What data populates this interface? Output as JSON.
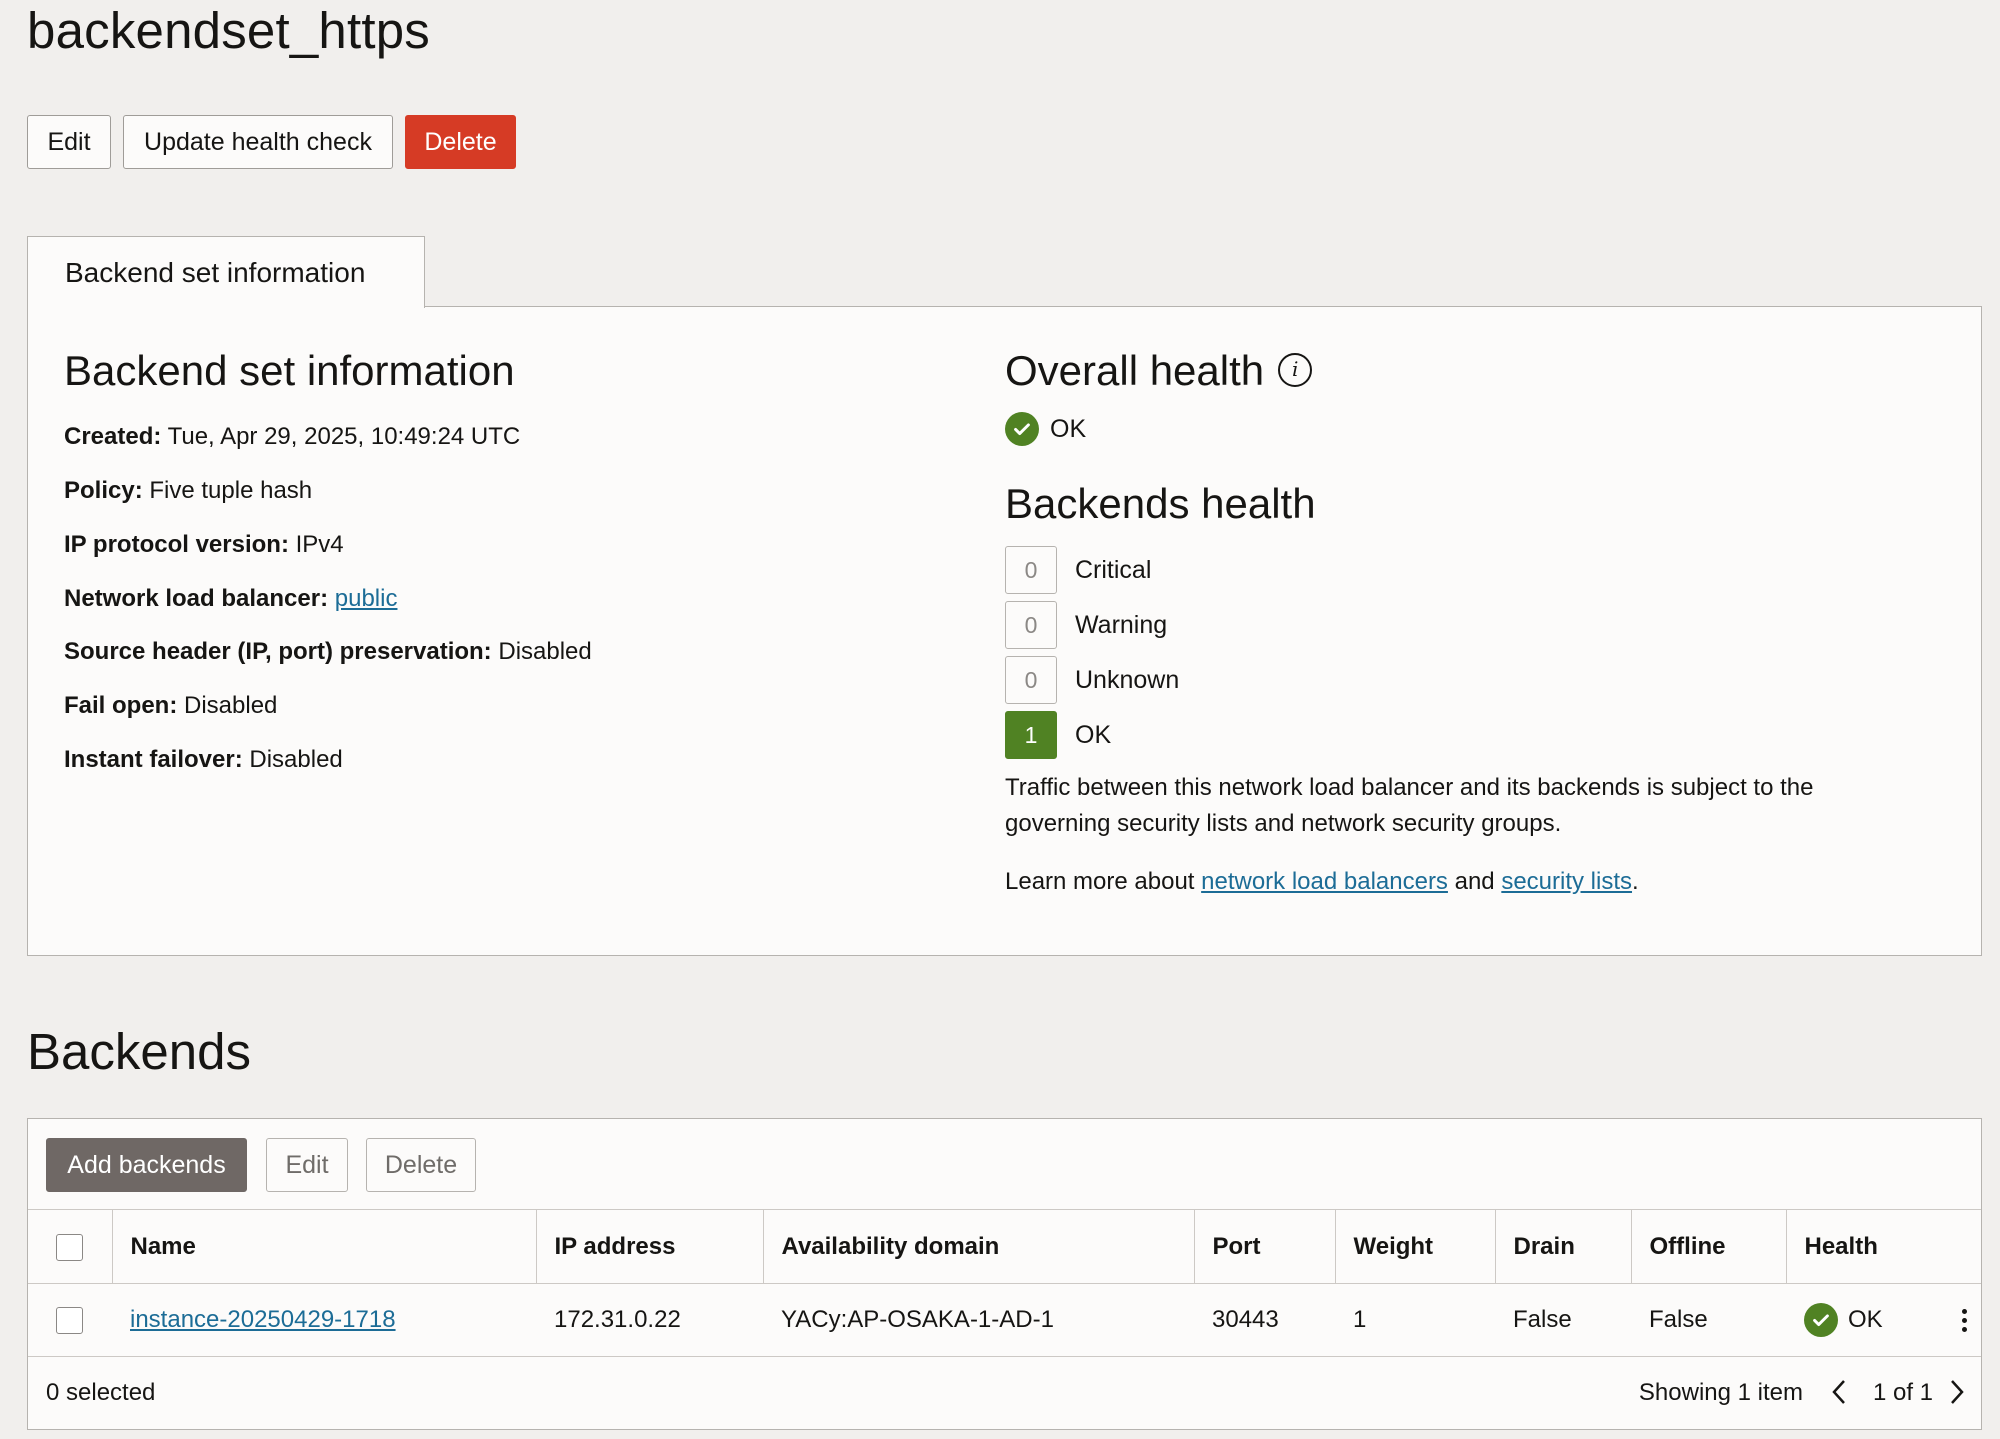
{
  "page": {
    "title": "backendset_https"
  },
  "toolbar": {
    "edit_label": "Edit",
    "update_health_label": "Update health check",
    "delete_label": "Delete"
  },
  "tabs": [
    {
      "label": "Backend set information"
    }
  ],
  "info": {
    "heading": "Backend set information",
    "created_label": "Created:",
    "created_value": "Tue, Apr 29, 2025, 10:49:24 UTC",
    "policy_label": "Policy:",
    "policy_value": "Five tuple hash",
    "ip_protocol_label": "IP protocol version:",
    "ip_protocol_value": "IPv4",
    "nlb_label": "Network load balancer:",
    "nlb_value": "public",
    "source_header_label": "Source header (IP, port) preservation:",
    "source_header_value": "Disabled",
    "fail_open_label": "Fail open:",
    "fail_open_value": "Disabled",
    "instant_failover_label": "Instant failover:",
    "instant_failover_value": "Disabled"
  },
  "health": {
    "overall_heading": "Overall health",
    "overall_status": "OK",
    "backends_heading": "Backends health",
    "counts": [
      {
        "count": "0",
        "label": "Critical"
      },
      {
        "count": "0",
        "label": "Warning"
      },
      {
        "count": "0",
        "label": "Unknown"
      },
      {
        "count": "1",
        "label": "OK"
      }
    ],
    "traffic_note": "Traffic between this network load balancer and its backends is subject to the governing security lists and network security groups.",
    "learn_prefix": "Learn more about ",
    "learn_link1": "network load balancers",
    "learn_mid": " and ",
    "learn_link2": "security lists",
    "learn_suffix": "."
  },
  "backends": {
    "heading": "Backends",
    "add_label": "Add backends",
    "edit_label": "Edit",
    "delete_label": "Delete",
    "columns": [
      "Name",
      "IP address",
      "Availability domain",
      "Port",
      "Weight",
      "Drain",
      "Offline",
      "Health"
    ],
    "rows": [
      {
        "name": "instance-20250429-1718",
        "ip": "172.31.0.22",
        "ad": "YACy:AP-OSAKA-1-AD-1",
        "port": "30443",
        "weight": "1",
        "drain": "False",
        "offline": "False",
        "health": "OK"
      }
    ],
    "selected_text": "0 selected",
    "showing_text": "Showing 1 item",
    "page_text": "1 of 1"
  },
  "colors": {
    "ok_green": "#508223",
    "danger_red": "#d63b25",
    "link_blue": "#1c6c96",
    "primary_dark": "#6f6865"
  },
  "icons": {
    "info": "info-icon",
    "ok": "check-circle-icon",
    "prev": "chevron-left-icon",
    "next": "chevron-right-icon",
    "actions": "kebab-menu-icon"
  }
}
